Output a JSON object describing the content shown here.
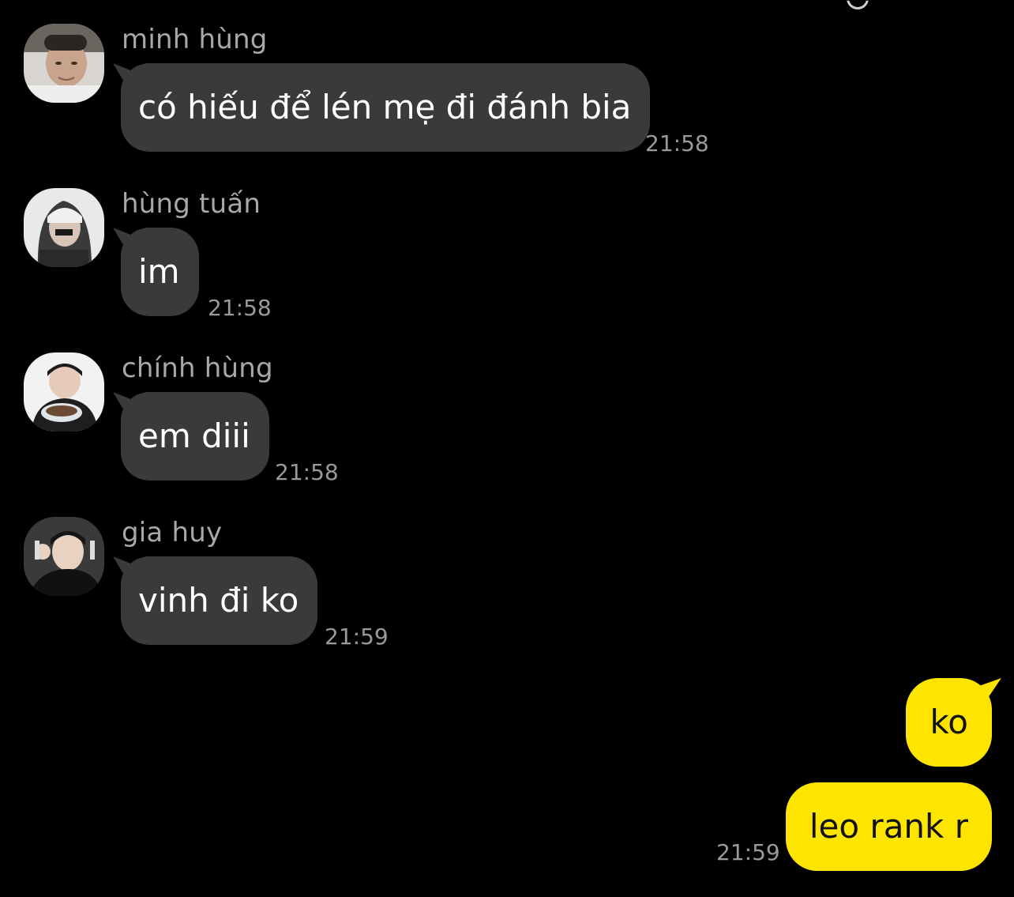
{
  "colors": {
    "background": "#000000",
    "incoming_bubble": "#3a3a3c",
    "outgoing_bubble": "#fee500",
    "sender_name": "#a8a8a8",
    "timestamp": "#9a9a9a"
  },
  "messages": [
    {
      "sender": "minh hùng",
      "text": "có hiếu để lén mẹ đi đánh bia",
      "time": "21:58"
    },
    {
      "sender": "hùng tuấn",
      "text": "im",
      "time": "21:58"
    },
    {
      "sender": "chính hùng",
      "text": "em diii",
      "time": "21:58"
    },
    {
      "sender": "gia huy",
      "text": "vinh đi ko",
      "time": "21:59"
    }
  ],
  "outgoing": [
    {
      "text": "ko"
    },
    {
      "text": "leo rank r",
      "time": "21:59"
    }
  ]
}
